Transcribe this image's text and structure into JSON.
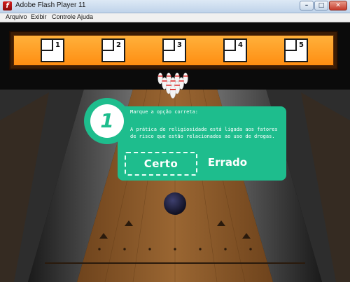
{
  "window": {
    "title": "Adobe Flash Player 11",
    "icon": "flash-icon",
    "icon_glyph": "f",
    "controls": {
      "minimize": "–",
      "maximize": "□",
      "close": "✕"
    }
  },
  "menu": {
    "items": [
      {
        "label": "Arquivo"
      },
      {
        "label": "Exibir"
      },
      {
        "label": "Controle"
      },
      {
        "label": "Ajuda"
      }
    ]
  },
  "scoreboard": {
    "frames": [
      "1",
      "2",
      "3",
      "4",
      "5"
    ]
  },
  "question": {
    "number": "1",
    "prompt": "Marque a opção correta:",
    "text": "A prática de religiosidade está ligada aos fatores de risco que estão relacionados ao uso de drogas.",
    "answers": {
      "correct": "Certo",
      "wrong": "Errado"
    }
  },
  "colors": {
    "accent": "#1ebd8d",
    "scoreboard": "#ff9a1f",
    "lane": "#8a5a2b",
    "ball": "#1a1a2e"
  }
}
